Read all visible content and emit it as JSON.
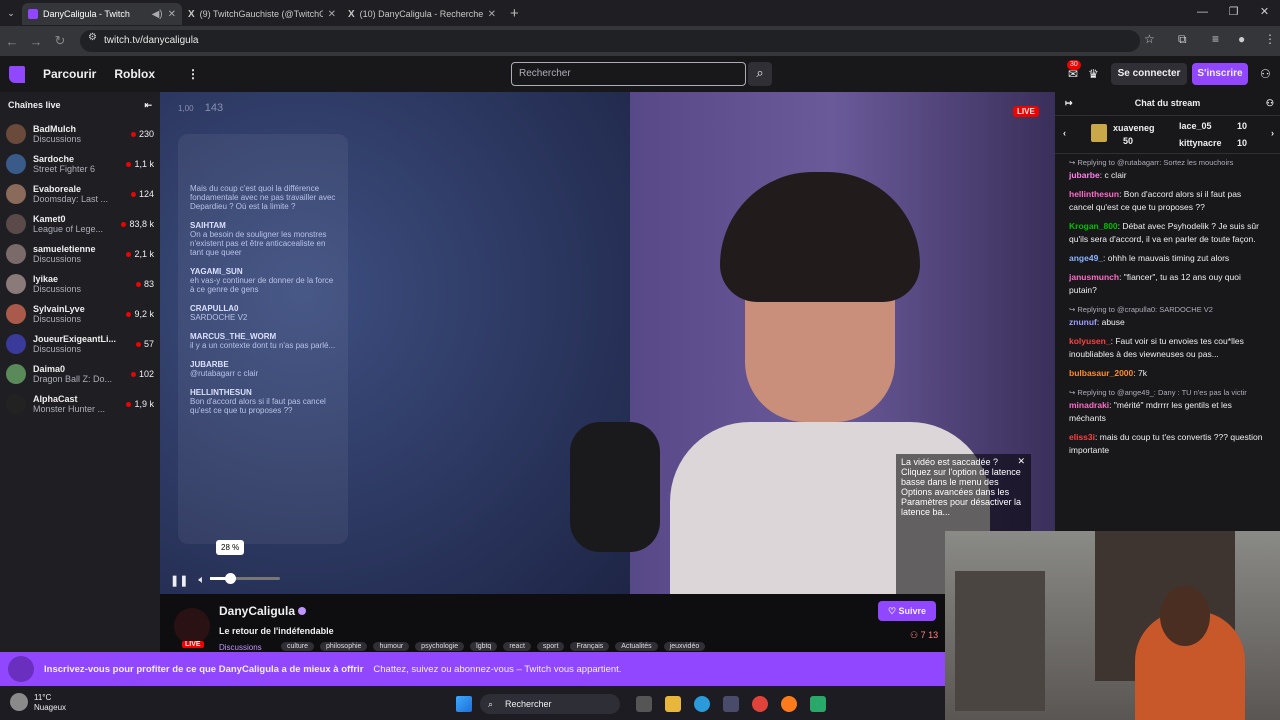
{
  "browser": {
    "tabs": [
      {
        "title": "DanyCaligula - Twitch",
        "active": true
      },
      {
        "title": "(9) TwitchGauchiste (@TwitchG",
        "active": false
      },
      {
        "title": "(10) DanyCaligula - Recherche /",
        "active": false
      }
    ],
    "url": "twitch.tv/danycaligula"
  },
  "topbar": {
    "browse": "Parcourir",
    "roblox": "Roblox",
    "search_placeholder": "Rechercher",
    "notif_count": "30",
    "login": "Se connecter",
    "signup": "S'inscrire"
  },
  "sidebar": {
    "title": "Chaînes live",
    "channels": [
      {
        "name": "BadMulch",
        "game": "Discussions",
        "viewers": "230",
        "color": "#6a4a3a"
      },
      {
        "name": "Sardoche",
        "game": "Street Fighter 6",
        "viewers": "1,1 k",
        "color": "#3a5a8a"
      },
      {
        "name": "Evaboreale",
        "game": "Doomsday: Last ...",
        "viewers": "124",
        "color": "#8a6a5a"
      },
      {
        "name": "Kamet0",
        "game": "League of Lege...",
        "viewers": "83,8 k",
        "color": "#5a4a4a"
      },
      {
        "name": "samueletienne",
        "game": "Discussions",
        "viewers": "2,1 k",
        "color": "#7a6a6a"
      },
      {
        "name": "lyikae",
        "game": "Discussions",
        "viewers": "83",
        "color": "#8a7a7a"
      },
      {
        "name": "SylvainLyve",
        "game": "Discussions",
        "viewers": "9,2 k",
        "color": "#aa5a4a"
      },
      {
        "name": "JoueurExigeantLi...",
        "game": "Discussions",
        "viewers": "57",
        "color": "#3a3a9a"
      },
      {
        "name": "Daima0",
        "game": "Dragon Ball Z: Do...",
        "viewers": "102",
        "color": "#5a8a5a"
      },
      {
        "name": "AlphaCast",
        "game": "Monster Hunter ...",
        "viewers": "1,9 k",
        "color": "#222222"
      }
    ]
  },
  "player": {
    "live": "LIVE",
    "overlay_timer": "1,00",
    "overlay_count": "143",
    "overlay_chat": [
      {
        "user": "",
        "text": "Mais du coup c'est quoi la différence fondamentale avec ne pas travailler avec Depardieu ? Où est la limite ?"
      },
      {
        "user": "SAIHTAM",
        "text": "On a besoin de souligner les monstres n'existent pas et être anticacealiste en tant que queer"
      },
      {
        "user": "YAGAMI_SUN",
        "text": "eh vas-y continuer de donner de la force à ce genre de gens"
      },
      {
        "user": "CRAPULLA0",
        "text": "SARDOCHE V2"
      },
      {
        "user": "MARCUS_THE_WORM",
        "text": "il y a un contexte dont tu n'as pas parlé..."
      },
      {
        "user": "JUBARBE",
        "text": "@rutabagarr c clair"
      },
      {
        "user": "HELLINTHESUN",
        "text": "Bon d'accord alors si il faut pas cancel qu'est ce que tu proposes ??"
      }
    ],
    "volume_percent": 28,
    "volume_label": "28 %",
    "latency_tip": "La vidéo est saccadée ? Cliquez sur l'option de latence basse dans le menu des Options avancées dans les Paramètres pour désactiver la latence ba..."
  },
  "stream_info": {
    "channel": "DanyCaligula",
    "title": "Le retour de l'indéfendable",
    "category": "Discussions",
    "live": "LIVE",
    "tags": [
      "culture",
      "philosophie",
      "humour",
      "psychologie",
      "lgbtq",
      "react",
      "sport",
      "Français",
      "Actualités",
      "jeuxvidéo"
    ],
    "follow": "Suivre",
    "viewers": "7 13"
  },
  "chat": {
    "title": "Chat du stream",
    "gifts": [
      {
        "user": "xuaveneg",
        "count": "50"
      },
      {
        "user": "lace_05",
        "count": "10"
      },
      {
        "user": "kittynacre",
        "count": "10"
      }
    ],
    "messages": [
      {
        "reply": "Replying to @rutabagarr: Sortez les mouchoirs",
        "user": "jubarbe",
        "color": "#ff7fe8",
        "text": "c clair"
      },
      {
        "reply": "",
        "user": "hellinthesun",
        "color": "#ff6bc8",
        "text": "Bon d'accord alors si il faut pas cancel qu'est ce que tu proposes ??"
      },
      {
        "reply": "",
        "user": "Krogan_800",
        "color": "#00c000",
        "text": "Débat avec Psyhodelik ? Je suis sûr qu'ils sera d'accord, il va en parler de toute façon."
      },
      {
        "reply": "",
        "user": "ange49_",
        "color": "#8ab4ff",
        "text": "ohhh le mauvais timing zut alors"
      },
      {
        "reply": "",
        "user": "janusmunch",
        "color": "#ff6bc8",
        "text": "\"fiancer\", tu as 12 ans ouy quoi putain?"
      },
      {
        "reply": "Replying to @crapulla0: SARDOCHE V2",
        "user": "znunuf",
        "color": "#9a9aff",
        "text": "abuse"
      },
      {
        "reply": "",
        "user": "kolyusen_",
        "color": "#ff4040",
        "text": "Faut voir si tu envoies tes cou*lles inoubliables à des viewneuses ou pas..."
      },
      {
        "reply": "",
        "user": "bulbasaur_2000",
        "color": "#ff8a2a",
        "text": "7k"
      },
      {
        "reply": "Replying to @ange49_: Dany : TU n'es pas la victir",
        "user": "minadraki",
        "color": "#ff6bc8",
        "text": "\"mérité\" mdrrrr les gentils et les méchants"
      },
      {
        "reply": "",
        "user": "eliss3i",
        "color": "#ff4040",
        "text": "mais du coup tu t'es convertis ??? question importante"
      }
    ]
  },
  "promo": {
    "main": "Inscrivez-vous pour profiter de ce que DanyCaligula a de mieux à offrir",
    "sub": "Chattez, suivez ou abonnez-vous – Twitch vous appartient."
  },
  "taskbar": {
    "temp": "11°C",
    "weather": "Nuageux",
    "search": "Rechercher"
  }
}
